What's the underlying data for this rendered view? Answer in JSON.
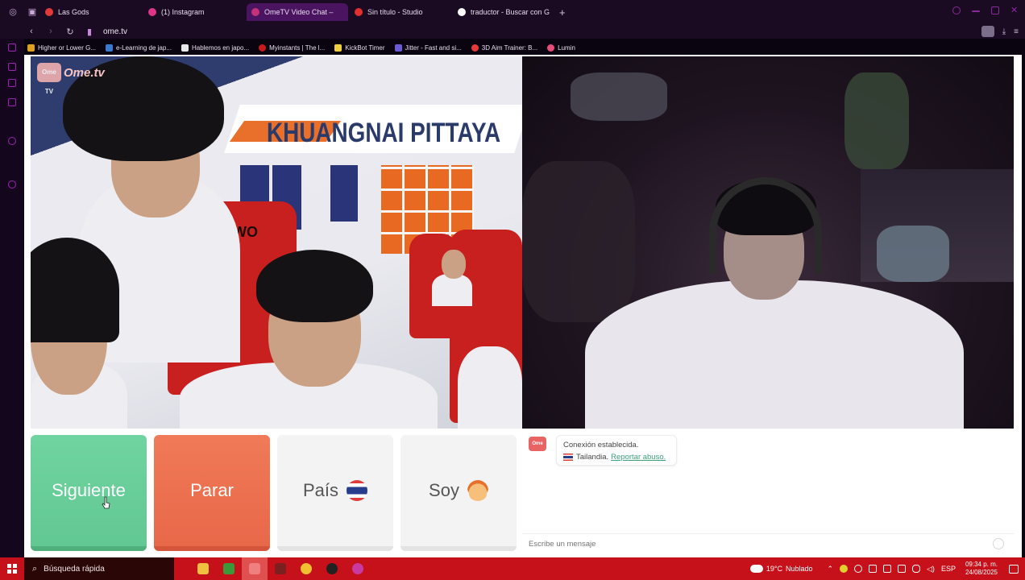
{
  "browser": {
    "tabs": [
      {
        "label": "Las Gods",
        "color": "#e23a3a",
        "active": false
      },
      {
        "label": "(1) Instagram",
        "color": "#e0338a",
        "active": false
      },
      {
        "label": "OmeTV Video Chat –",
        "color": "#c4327a",
        "active": true
      },
      {
        "label": "Sin título - Studio",
        "color": "#e03030",
        "active": false
      },
      {
        "label": "traductor - Buscar con G",
        "color": "#ffffff",
        "active": false
      }
    ],
    "new_tab_glyph": "+",
    "url": "ome.tv",
    "bookmarks": [
      {
        "label": "Higher or Lower G...",
        "color": "#e0a020"
      },
      {
        "label": "e-Learning de jap...",
        "color": "#3a7ad0"
      },
      {
        "label": "Hablemos en japo...",
        "color": "#e8e8e8"
      },
      {
        "label": "Myinstants | The l...",
        "color": "#c81a1a"
      },
      {
        "label": "KickBot Timer",
        "color": "#f0d040"
      },
      {
        "label": "Jitter - Fast and si...",
        "color": "#6a5ad8"
      },
      {
        "label": "3D Aim Trainer: B...",
        "color": "#e83a3a"
      },
      {
        "label": "Lumin",
        "color": "#e84a7a"
      }
    ]
  },
  "page": {
    "logo_text": "Ome.tv",
    "logo_badge": "Ome TV",
    "left_video": {
      "sign_text": "KHUANGNAI PITTAYA",
      "chair_text": "NUBWO"
    },
    "controls": {
      "next_label": "Siguiente",
      "stop_label": "Parar",
      "country_label": "País",
      "gender_label": "Soy"
    },
    "chat": {
      "logo_badge": "Ome TV",
      "status_text": "Conexión establecida.",
      "country_text": "Tailandia.",
      "report_text": "Reportar abuso.",
      "input_placeholder": "Escribe un mensaje"
    }
  },
  "taskbar": {
    "search_placeholder": "Búsqueda rápida",
    "weather_temp": "19°C",
    "weather_text": "Nublado",
    "language": "ESP",
    "time": "09:34 p. m.",
    "date": "24/08/2025"
  },
  "colors": {
    "next_button": "#6fd4a0",
    "stop_button": "#f07a58",
    "taskbar": "#c6101a",
    "accent": "#a020b8"
  }
}
